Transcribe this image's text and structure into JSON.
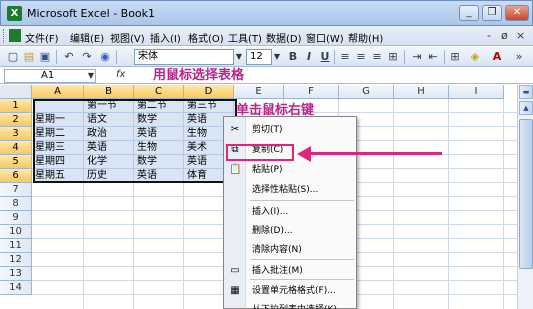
{
  "window": {
    "title": "Microsoft Excel - Book1",
    "app_icon_glyph": "X",
    "minimize_glyph": "_",
    "restore_glyph": "❐",
    "close_glyph": "✕"
  },
  "menubar": {
    "items": [
      "文件(F)",
      "编辑(E)",
      "视图(V)",
      "插入(I)",
      "格式(O)",
      "工具(T)",
      "数据(D)",
      "窗口(W)",
      "帮助(H)"
    ],
    "mdi_minimize": "-",
    "mdi_restore": "ø",
    "mdi_close": "×"
  },
  "toolbar": {
    "font_name": "宋体",
    "font_size": "12",
    "bold": "B",
    "italic": "I",
    "underline": "U"
  },
  "formula_bar": {
    "cell_ref": "A1",
    "fx_label": "fx",
    "value": ""
  },
  "sheet": {
    "columns": [
      "A",
      "B",
      "C",
      "D",
      "E",
      "F",
      "G",
      "H",
      "I"
    ],
    "rows": [
      "1",
      "2",
      "3",
      "4",
      "5",
      "6",
      "7",
      "8",
      "9",
      "10",
      "11",
      "12",
      "13",
      "14"
    ],
    "cells": [
      [
        "",
        "第一节",
        "第二节",
        "第三节"
      ],
      [
        "星期一",
        "语文",
        "数学",
        "英语"
      ],
      [
        "星期二",
        "政治",
        "英语",
        "生物"
      ],
      [
        "星期三",
        "英语",
        "生物",
        "美术"
      ],
      [
        "星期四",
        "化学",
        "数学",
        "英语"
      ],
      [
        "星期五",
        "历史",
        "英语",
        "体育"
      ]
    ]
  },
  "annotations": {
    "select_table": "用鼠标选择表格",
    "right_click": "单击鼠标右键"
  },
  "context_menu": {
    "items": [
      {
        "label": "剪切(T)",
        "icon": "scissors-icon",
        "glyph": "✂"
      },
      {
        "label": "复制(C)",
        "icon": "copy-icon",
        "glyph": "⧉"
      },
      {
        "label": "粘贴(P)",
        "icon": "paste-icon",
        "glyph": "📋"
      },
      {
        "label": "选择性粘贴(S)...",
        "icon": "",
        "glyph": ""
      },
      {
        "label": "插入(I)...",
        "icon": "",
        "glyph": ""
      },
      {
        "label": "删除(D)...",
        "icon": "",
        "glyph": ""
      },
      {
        "label": "清除内容(N)",
        "icon": "",
        "glyph": ""
      },
      {
        "label": "插入批注(M)",
        "icon": "comment-icon",
        "glyph": "▭"
      },
      {
        "label": "设置单元格格式(F)...",
        "icon": "format-cells-icon",
        "glyph": "▦"
      },
      {
        "label": "从下拉列表中选择(K)...",
        "icon": "",
        "glyph": ""
      }
    ]
  },
  "colors": {
    "annotation": "#b8258c",
    "highlight": "#e0267c",
    "selection": "#78a0dc"
  }
}
